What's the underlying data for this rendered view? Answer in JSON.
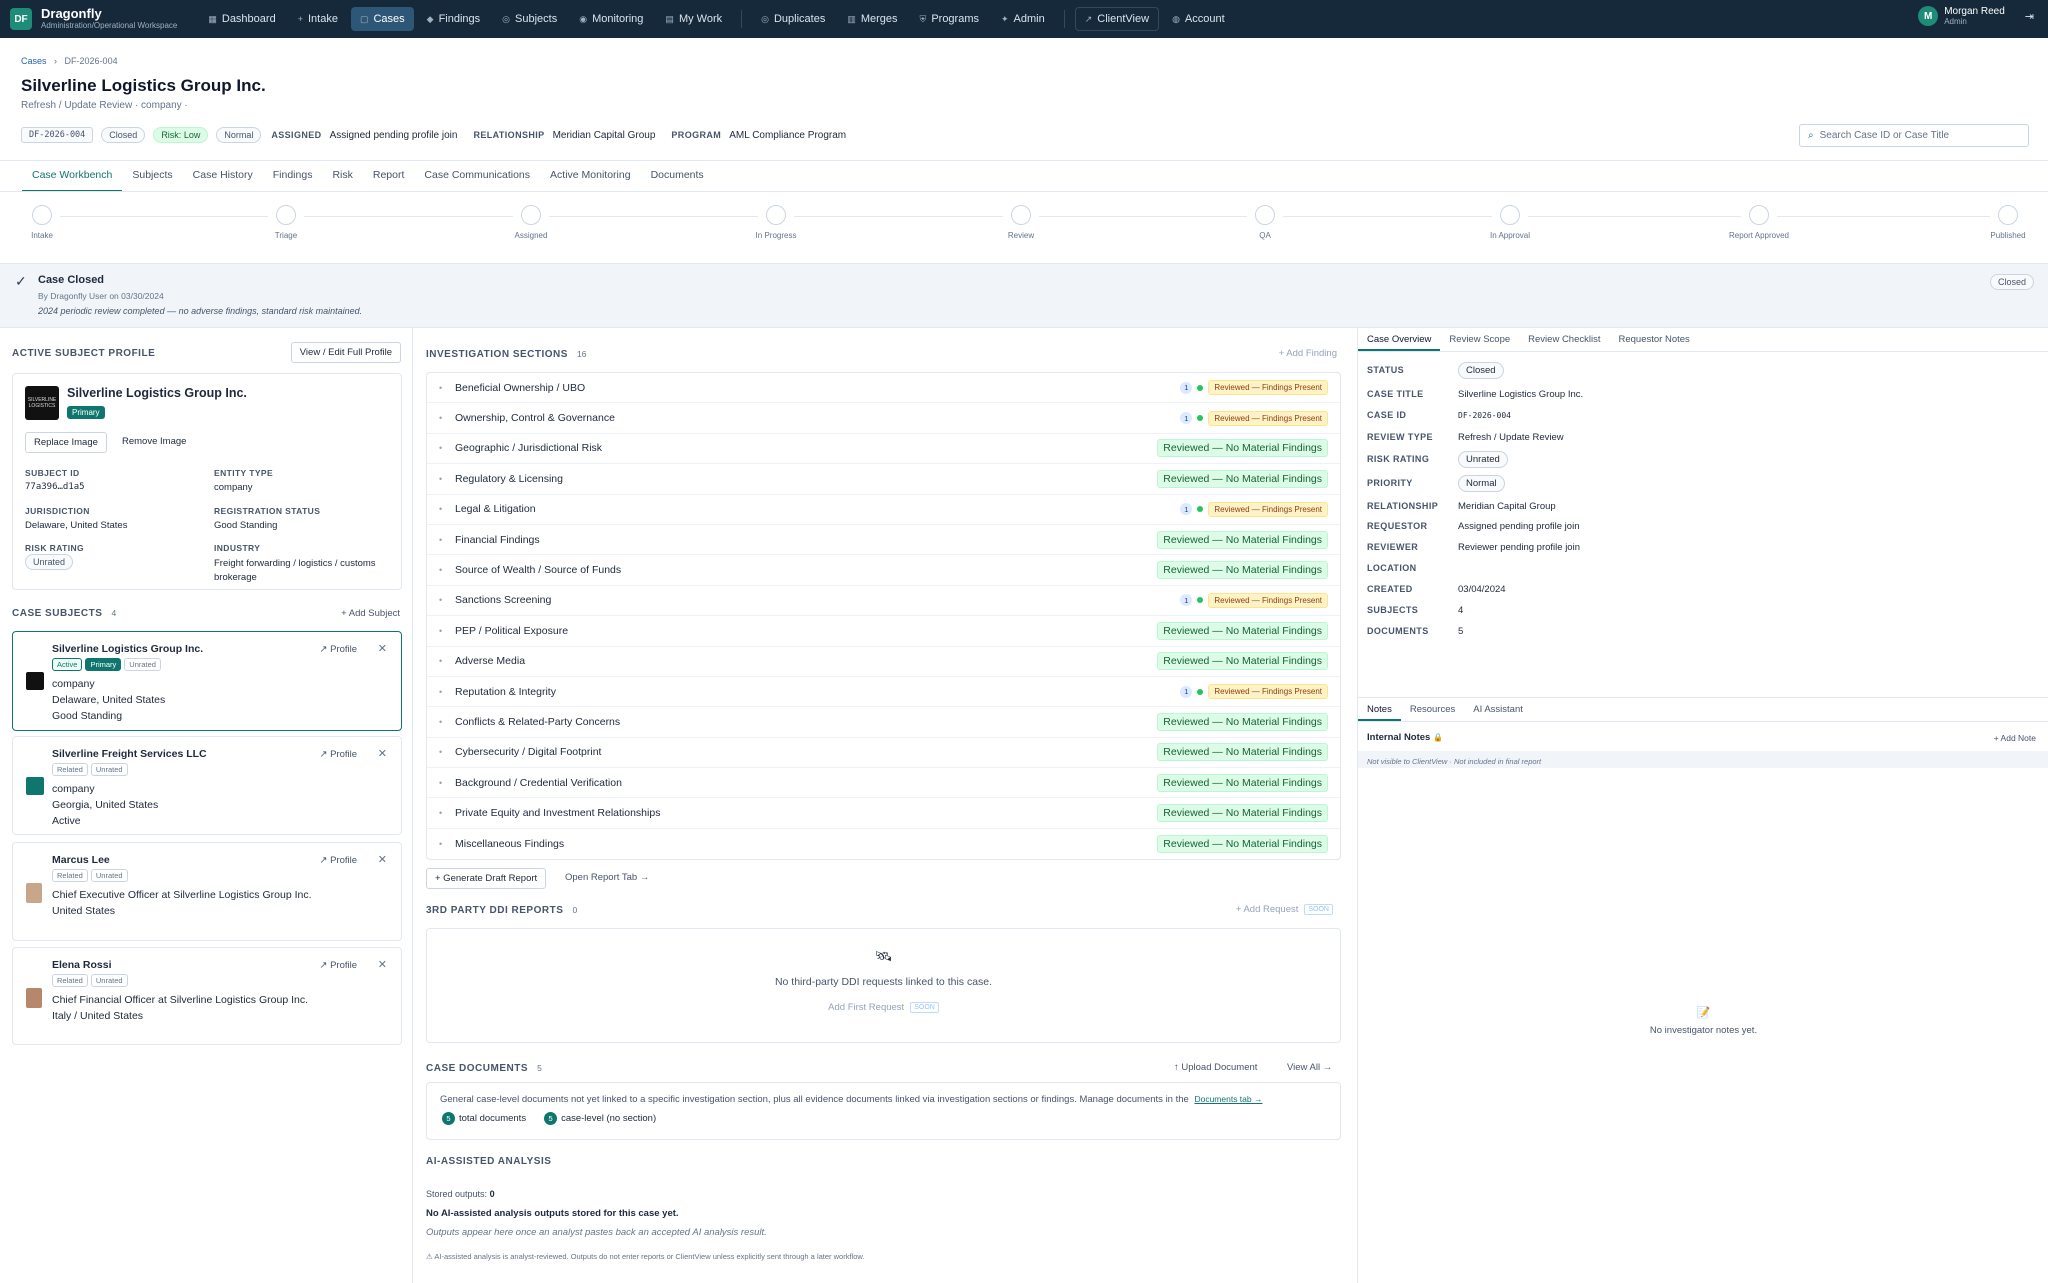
{
  "app": {
    "logo": "DF",
    "name": "Dragonfly",
    "workspace": "Administration/Operational Workspace"
  },
  "nav": [
    {
      "label": "Dashboard",
      "icon": "grid-icon",
      "glyph": "▦"
    },
    {
      "label": "Intake",
      "icon": "plus-icon",
      "glyph": "+"
    },
    {
      "label": "Cases",
      "icon": "folder-icon",
      "glyph": "▢",
      "active": true
    },
    {
      "label": "Findings",
      "icon": "diamond-icon",
      "glyph": "◆"
    },
    {
      "label": "Subjects",
      "icon": "target-icon",
      "glyph": "◎"
    },
    {
      "label": "Monitoring",
      "icon": "eye-icon",
      "glyph": "◉"
    },
    {
      "label": "My Work",
      "icon": "calendar-icon",
      "glyph": "▤"
    },
    {
      "label": "Duplicates",
      "icon": "duplicate-icon",
      "glyph": "◎"
    },
    {
      "label": "Merges",
      "icon": "merge-icon",
      "glyph": "▥"
    },
    {
      "label": "Programs",
      "icon": "shield-icon",
      "glyph": "⛨"
    },
    {
      "label": "Admin",
      "icon": "gear-icon",
      "glyph": "✦"
    },
    {
      "label": "ClientView",
      "icon": "external-link-icon",
      "glyph": "↗"
    },
    {
      "label": "Account",
      "icon": "person-icon",
      "glyph": "◍"
    }
  ],
  "user": {
    "initial": "M",
    "name": "Morgan Reed",
    "role": "Admin",
    "logout_glyph": "⇥"
  },
  "breadcrumb": {
    "root": "Cases",
    "sep": "›",
    "current": "DF-2026-004"
  },
  "case": {
    "title": "Silverline Logistics Group Inc.",
    "subtitle": "Refresh / Update Review · company ·",
    "id": "DF-2026-004",
    "status": "Closed",
    "risk": "Risk: Low",
    "priority": "Normal",
    "assigned_label": "ASSIGNED",
    "assigned": "Assigned pending profile join",
    "relationship_label": "RELATIONSHIP",
    "relationship": "Meridian Capital Group",
    "program_label": "PROGRAM",
    "program": "AML Compliance Program"
  },
  "search": {
    "placeholder": "Search Case ID or Case Title",
    "icon": "⌕"
  },
  "tabs": [
    "Case Workbench",
    "Subjects",
    "Case History",
    "Findings",
    "Risk",
    "Report",
    "Case Communications",
    "Active Monitoring",
    "Documents"
  ],
  "stages": [
    "Intake",
    "Triage",
    "Assigned",
    "In Progress",
    "Review",
    "QA",
    "In Approval",
    "Report Approved",
    "Published"
  ],
  "closed_banner": {
    "check": "✓",
    "title": "Case Closed",
    "by": "By Dragonfly User on 03/30/2024",
    "message": "2024 periodic review completed — no adverse findings, standard risk maintained.",
    "status": "Closed"
  },
  "profile": {
    "heading": "ACTIVE SUBJECT PROFILE",
    "view_btn": "View / Edit Full Profile",
    "logo_text": "SILVERLINE LOGISTICS",
    "name": "Silverline Logistics Group Inc.",
    "badge": "Primary",
    "replace_btn": "Replace Image",
    "remove_btn": "Remove Image",
    "fields": {
      "subject_id_label": "SUBJECT ID",
      "subject_id": "77a396…d1a5",
      "entity_type_label": "ENTITY TYPE",
      "entity_type": "company",
      "jurisdiction_label": "JURISDICTION",
      "jurisdiction": "Delaware, United States",
      "reg_status_label": "REGISTRATION STATUS",
      "reg_status": "Good Standing",
      "risk_label": "RISK RATING",
      "risk": "Unrated",
      "industry_label": "INDUSTRY",
      "industry": "Freight forwarding / logistics / customs brokerage"
    }
  },
  "case_subjects": {
    "heading": "CASE SUBJECTS",
    "count": "4",
    "add": "+ Add Subject",
    "profile_btn": "↗ Profile",
    "remove": "✕",
    "items": [
      {
        "name": "Silverline Logistics Group Inc.",
        "badges": [
          "Active",
          "Primary",
          "Unrated"
        ],
        "lines": [
          "company",
          "Delaware, United States",
          "Good Standing"
        ]
      },
      {
        "name": "Silverline Freight Services LLC",
        "badges": [
          "Related",
          "Unrated"
        ],
        "lines": [
          "company",
          "Georgia, United States",
          "Active"
        ]
      },
      {
        "name": "Marcus Lee",
        "badges": [
          "Related",
          "Unrated"
        ],
        "lines": [
          "Chief Executive Officer at Silverline Logistics Group Inc.",
          "United States"
        ]
      },
      {
        "name": "Elena Rossi",
        "badges": [
          "Related",
          "Unrated"
        ],
        "lines": [
          "Chief Financial Officer at Silverline Logistics Group Inc.",
          "Italy / United States"
        ]
      }
    ]
  },
  "investigation": {
    "heading": "INVESTIGATION SECTIONS",
    "count": "16",
    "add": "+ Add Finding",
    "sections": [
      {
        "name": "Beneficial Ownership / UBO",
        "count": "1",
        "status": "Reviewed — Findings Present",
        "type": "fp"
      },
      {
        "name": "Ownership, Control & Governance",
        "count": "1",
        "status": "Reviewed — Findings Present",
        "type": "fp"
      },
      {
        "name": "Geographic / Jurisdictional Risk",
        "count": "",
        "status": "Reviewed — No Material Findings",
        "type": "nm"
      },
      {
        "name": "Regulatory & Licensing",
        "count": "",
        "status": "Reviewed — No Material Findings",
        "type": "nm"
      },
      {
        "name": "Legal & Litigation",
        "count": "1",
        "status": "Reviewed — Findings Present",
        "type": "fp"
      },
      {
        "name": "Financial Findings",
        "count": "",
        "status": "Reviewed — No Material Findings",
        "type": "nm"
      },
      {
        "name": "Source of Wealth / Source of Funds",
        "count": "",
        "status": "Reviewed — No Material Findings",
        "type": "nm"
      },
      {
        "name": "Sanctions Screening",
        "count": "1",
        "status": "Reviewed — Findings Present",
        "type": "fp"
      },
      {
        "name": "PEP / Political Exposure",
        "count": "",
        "status": "Reviewed — No Material Findings",
        "type": "nm"
      },
      {
        "name": "Adverse Media",
        "count": "",
        "status": "Reviewed — No Material Findings",
        "type": "nm"
      },
      {
        "name": "Reputation & Integrity",
        "count": "1",
        "status": "Reviewed — Findings Present",
        "type": "fp"
      },
      {
        "name": "Conflicts & Related-Party Concerns",
        "count": "",
        "status": "Reviewed — No Material Findings",
        "type": "nm"
      },
      {
        "name": "Cybersecurity / Digital Footprint",
        "count": "",
        "status": "Reviewed — No Material Findings",
        "type": "nm"
      },
      {
        "name": "Background / Credential Verification",
        "count": "",
        "status": "Reviewed — No Material Findings",
        "type": "nm"
      },
      {
        "name": "Private Equity and Investment Relationships",
        "count": "",
        "status": "Reviewed — No Material Findings",
        "type": "nm"
      },
      {
        "name": "Miscellaneous Findings",
        "count": "",
        "status": "Reviewed — No Material Findings",
        "type": "nm"
      }
    ],
    "gen_btn": "+ Generate Draft Report",
    "open_btn": "Open Report Tab →"
  },
  "ddi": {
    "heading": "3RD PARTY DDI REPORTS",
    "count": "0",
    "add": "+ Add Request",
    "soon": "SOON",
    "icon": "🛰",
    "empty": "No third-party DDI requests linked to this case.",
    "first": "Add First Request"
  },
  "documents": {
    "heading": "CASE DOCUMENTS",
    "count": "5",
    "upload": "↑ Upload Document",
    "view_all": "View All →",
    "desc": "General case-level documents not yet linked to a specific investigation section, plus all evidence documents linked via investigation sections or findings. Manage documents in the",
    "link": "Documents tab →",
    "total_n": "5",
    "total_label": "total documents",
    "case_n": "5",
    "case_label": "case-level (no section)"
  },
  "ai": {
    "heading": "AI-ASSISTED ANALYSIS",
    "stored_label": "Stored outputs:",
    "stored": "0",
    "none": "No AI-assisted analysis outputs stored for this case yet.",
    "hint": "Outputs appear here once an analyst pastes back an accepted AI analysis result.",
    "warn": "⚠ AI-assisted analysis is analyst-reviewed. Outputs do not enter reports or ClientView unless explicitly sent through a later workflow."
  },
  "overview": {
    "tabs": [
      "Case Overview",
      "Review Scope",
      "Review Checklist",
      "Requestor Notes"
    ],
    "rows": [
      {
        "k": "STATUS",
        "v": "Closed",
        "pill": true
      },
      {
        "k": "CASE TITLE",
        "v": "Silverline Logistics Group Inc."
      },
      {
        "k": "CASE ID",
        "v": "DF-2026-004",
        "mono": true
      },
      {
        "k": "REVIEW TYPE",
        "v": "Refresh / Update Review"
      },
      {
        "k": "RISK RATING",
        "v": "Unrated",
        "pill": true
      },
      {
        "k": "PRIORITY",
        "v": "Normal",
        "pill": true
      },
      {
        "k": "RELATIONSHIP",
        "v": "Meridian Capital Group"
      },
      {
        "k": "REQUESTOR",
        "v": "Assigned pending profile join"
      },
      {
        "k": "REVIEWER",
        "v": "Reviewer pending profile join"
      },
      {
        "k": "LOCATION",
        "v": ""
      },
      {
        "k": "CREATED",
        "v": "03/04/2024"
      },
      {
        "k": "SUBJECTS",
        "v": "4"
      },
      {
        "k": "DOCUMENTS",
        "v": "5"
      }
    ]
  },
  "notes": {
    "tabs": [
      "Notes",
      "Resources",
      "AI Assistant"
    ],
    "heading": "Internal Notes",
    "lock": "🔒",
    "add": "+ Add Note",
    "note": "Not visible to ClientView · Not included in final report",
    "icon": "📝",
    "empty": "No investigator notes yet."
  }
}
